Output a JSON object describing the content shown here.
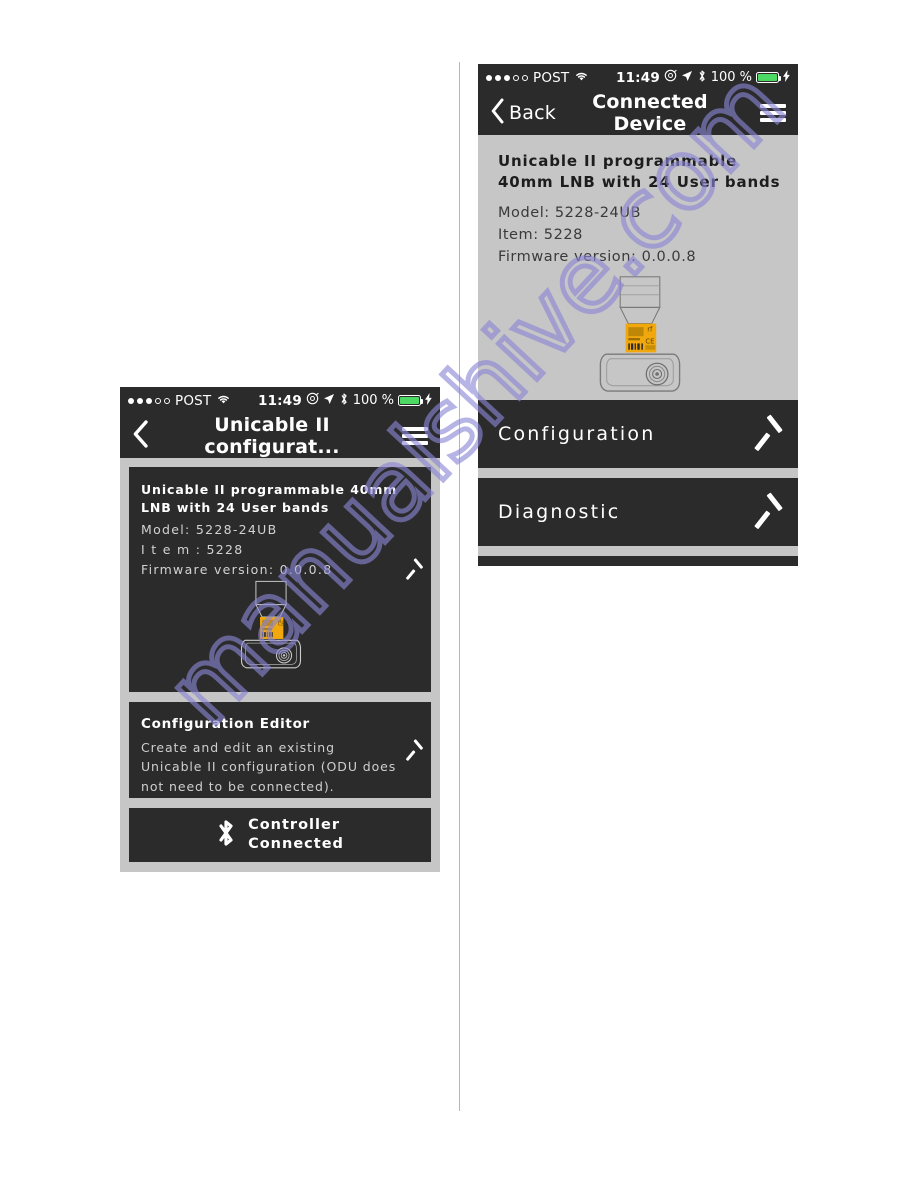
{
  "watermark": {
    "text": "manualshive.com",
    "color": "#8b86d6"
  },
  "left_screen": {
    "status_bar": {
      "carrier": "POST",
      "signal_dots_filled": 3,
      "signal_dots_total": 5,
      "wifi_icon": "wifi-icon",
      "time": "11:49",
      "alarm_icon": "alarm-icon",
      "location_icon": "location-arrow-icon",
      "bluetooth_icon": "bluetooth-icon",
      "battery_percent": "100 %",
      "battery_icon": "battery-full-icon",
      "charging_icon": "lightning-bolt-icon"
    },
    "nav": {
      "back_icon": "chevron-left-icon",
      "back_label": "",
      "title": "Unicable II configurat...",
      "menu_icon": "hamburger-menu-icon"
    },
    "device_card": {
      "title": "Unicable II programmable 40mm LNB with 24 User bands",
      "model_line": "Model:  5228-24UB",
      "item_line": "I t e m :  5228",
      "firmware_line": "Firmware version:  0.0.0.8",
      "image_icon": "lnb-device-image",
      "chevron_icon": "chevron-right-icon"
    },
    "editor_card": {
      "title": "Configuration Editor",
      "description": "Create and edit an existing Unicable II configuration (ODU does not need to be connected).",
      "chevron_icon": "chevron-right-icon"
    },
    "footer": {
      "bluetooth_icon": "bluetooth-icon",
      "line1": "Controller",
      "line2": "Connected"
    }
  },
  "right_screen": {
    "status_bar": {
      "carrier": "POST",
      "signal_dots_filled": 3,
      "signal_dots_total": 5,
      "wifi_icon": "wifi-icon",
      "time": "11:49",
      "alarm_icon": "alarm-icon",
      "location_icon": "location-arrow-icon",
      "bluetooth_icon": "bluetooth-icon",
      "battery_percent": "100 %",
      "battery_icon": "battery-full-icon",
      "charging_icon": "lightning-bolt-icon"
    },
    "nav": {
      "back_icon": "chevron-left-icon",
      "back_label": "Back",
      "title": "Connected Device",
      "menu_icon": "hamburger-menu-icon"
    },
    "device_pane": {
      "title_line1": "Unicable II programmable",
      "title_line2": "40mm LNB with 24 User bands",
      "model_line": "Model: 5228-24UB",
      "item_line": "Item: 5228",
      "firmware_line": "Firmware version: 0.0.0.8",
      "image_icon": "lnb-device-image"
    },
    "rows": [
      {
        "label": "Configuration",
        "chevron_icon": "chevron-right-icon"
      },
      {
        "label": "Diagnostic",
        "chevron_icon": "chevron-right-icon"
      }
    ]
  },
  "colors": {
    "screen_bg": "#c6c6c6",
    "card_bg": "#2b2b2b",
    "battery_green": "#4cd964",
    "label_yellow": "#f0a80d",
    "divider": "#b6b6b6"
  }
}
